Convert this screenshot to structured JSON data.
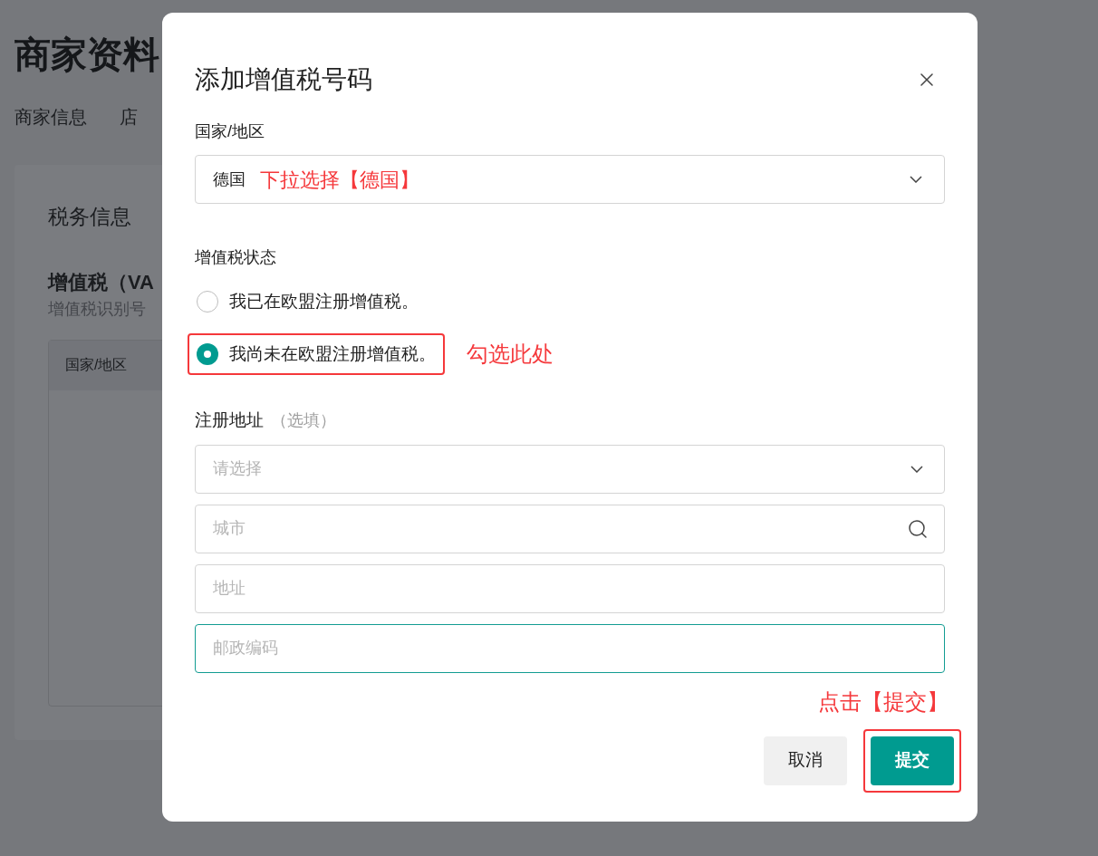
{
  "page": {
    "title": "商家资料",
    "tabs": [
      "商家信息",
      "店"
    ],
    "section_title": "税务信息",
    "vat_title": "增值税（VA",
    "vat_subtitle": "增值税识别号",
    "table": {
      "columns": [
        "国家/地区"
      ]
    }
  },
  "dialog": {
    "title": "添加增值税号码",
    "country": {
      "label": "国家/地区",
      "value": "德国",
      "note": "下拉选择【德国】"
    },
    "vat_status": {
      "label": "增值税状态",
      "options": [
        {
          "label": "我已在欧盟注册增值税。",
          "selected": false,
          "highlighted": false
        },
        {
          "label": "我尚未在欧盟注册增值税。",
          "selected": true,
          "highlighted": true,
          "note": "勾选此处"
        }
      ]
    },
    "address": {
      "label": "注册地址",
      "hint": "（选填）",
      "fields": [
        {
          "kind": "select",
          "placeholder": "请选择",
          "focused": false
        },
        {
          "kind": "search",
          "placeholder": "城市",
          "focused": false
        },
        {
          "kind": "text",
          "placeholder": "地址",
          "focused": false
        },
        {
          "kind": "text",
          "placeholder": "邮政编码",
          "focused": true
        }
      ]
    },
    "submit_note": "点击【提交】",
    "buttons": [
      {
        "label": "取消",
        "kind": "secondary",
        "highlighted": false
      },
      {
        "label": "提交",
        "kind": "primary",
        "highlighted": true
      }
    ]
  }
}
